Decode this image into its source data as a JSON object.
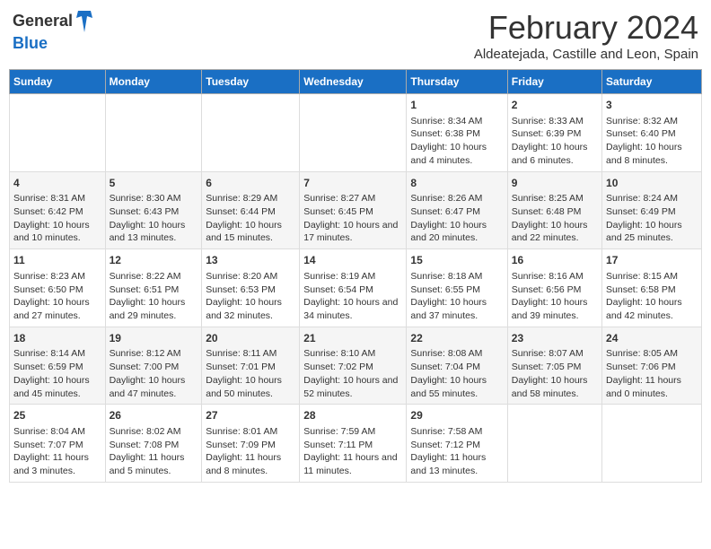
{
  "header": {
    "logo_general": "General",
    "logo_blue": "Blue",
    "month_title": "February 2024",
    "location": "Aldeatejada, Castille and Leon, Spain"
  },
  "days_of_week": [
    "Sunday",
    "Monday",
    "Tuesday",
    "Wednesday",
    "Thursday",
    "Friday",
    "Saturday"
  ],
  "weeks": [
    [
      {
        "num": "",
        "info": ""
      },
      {
        "num": "",
        "info": ""
      },
      {
        "num": "",
        "info": ""
      },
      {
        "num": "",
        "info": ""
      },
      {
        "num": "1",
        "info": "Sunrise: 8:34 AM\nSunset: 6:38 PM\nDaylight: 10 hours and 4 minutes."
      },
      {
        "num": "2",
        "info": "Sunrise: 8:33 AM\nSunset: 6:39 PM\nDaylight: 10 hours and 6 minutes."
      },
      {
        "num": "3",
        "info": "Sunrise: 8:32 AM\nSunset: 6:40 PM\nDaylight: 10 hours and 8 minutes."
      }
    ],
    [
      {
        "num": "4",
        "info": "Sunrise: 8:31 AM\nSunset: 6:42 PM\nDaylight: 10 hours and 10 minutes."
      },
      {
        "num": "5",
        "info": "Sunrise: 8:30 AM\nSunset: 6:43 PM\nDaylight: 10 hours and 13 minutes."
      },
      {
        "num": "6",
        "info": "Sunrise: 8:29 AM\nSunset: 6:44 PM\nDaylight: 10 hours and 15 minutes."
      },
      {
        "num": "7",
        "info": "Sunrise: 8:27 AM\nSunset: 6:45 PM\nDaylight: 10 hours and 17 minutes."
      },
      {
        "num": "8",
        "info": "Sunrise: 8:26 AM\nSunset: 6:47 PM\nDaylight: 10 hours and 20 minutes."
      },
      {
        "num": "9",
        "info": "Sunrise: 8:25 AM\nSunset: 6:48 PM\nDaylight: 10 hours and 22 minutes."
      },
      {
        "num": "10",
        "info": "Sunrise: 8:24 AM\nSunset: 6:49 PM\nDaylight: 10 hours and 25 minutes."
      }
    ],
    [
      {
        "num": "11",
        "info": "Sunrise: 8:23 AM\nSunset: 6:50 PM\nDaylight: 10 hours and 27 minutes."
      },
      {
        "num": "12",
        "info": "Sunrise: 8:22 AM\nSunset: 6:51 PM\nDaylight: 10 hours and 29 minutes."
      },
      {
        "num": "13",
        "info": "Sunrise: 8:20 AM\nSunset: 6:53 PM\nDaylight: 10 hours and 32 minutes."
      },
      {
        "num": "14",
        "info": "Sunrise: 8:19 AM\nSunset: 6:54 PM\nDaylight: 10 hours and 34 minutes."
      },
      {
        "num": "15",
        "info": "Sunrise: 8:18 AM\nSunset: 6:55 PM\nDaylight: 10 hours and 37 minutes."
      },
      {
        "num": "16",
        "info": "Sunrise: 8:16 AM\nSunset: 6:56 PM\nDaylight: 10 hours and 39 minutes."
      },
      {
        "num": "17",
        "info": "Sunrise: 8:15 AM\nSunset: 6:58 PM\nDaylight: 10 hours and 42 minutes."
      }
    ],
    [
      {
        "num": "18",
        "info": "Sunrise: 8:14 AM\nSunset: 6:59 PM\nDaylight: 10 hours and 45 minutes."
      },
      {
        "num": "19",
        "info": "Sunrise: 8:12 AM\nSunset: 7:00 PM\nDaylight: 10 hours and 47 minutes."
      },
      {
        "num": "20",
        "info": "Sunrise: 8:11 AM\nSunset: 7:01 PM\nDaylight: 10 hours and 50 minutes."
      },
      {
        "num": "21",
        "info": "Sunrise: 8:10 AM\nSunset: 7:02 PM\nDaylight: 10 hours and 52 minutes."
      },
      {
        "num": "22",
        "info": "Sunrise: 8:08 AM\nSunset: 7:04 PM\nDaylight: 10 hours and 55 minutes."
      },
      {
        "num": "23",
        "info": "Sunrise: 8:07 AM\nSunset: 7:05 PM\nDaylight: 10 hours and 58 minutes."
      },
      {
        "num": "24",
        "info": "Sunrise: 8:05 AM\nSunset: 7:06 PM\nDaylight: 11 hours and 0 minutes."
      }
    ],
    [
      {
        "num": "25",
        "info": "Sunrise: 8:04 AM\nSunset: 7:07 PM\nDaylight: 11 hours and 3 minutes."
      },
      {
        "num": "26",
        "info": "Sunrise: 8:02 AM\nSunset: 7:08 PM\nDaylight: 11 hours and 5 minutes."
      },
      {
        "num": "27",
        "info": "Sunrise: 8:01 AM\nSunset: 7:09 PM\nDaylight: 11 hours and 8 minutes."
      },
      {
        "num": "28",
        "info": "Sunrise: 7:59 AM\nSunset: 7:11 PM\nDaylight: 11 hours and 11 minutes."
      },
      {
        "num": "29",
        "info": "Sunrise: 7:58 AM\nSunset: 7:12 PM\nDaylight: 11 hours and 13 minutes."
      },
      {
        "num": "",
        "info": ""
      },
      {
        "num": "",
        "info": ""
      }
    ]
  ]
}
